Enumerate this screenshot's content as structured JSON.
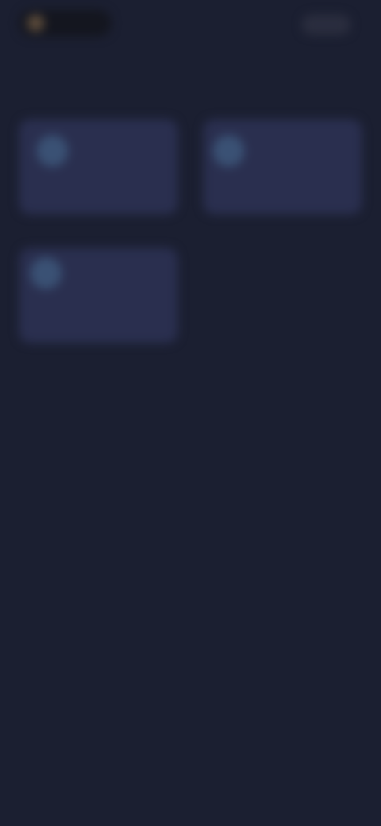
{
  "header": {
    "brand_name": "",
    "action_label": ""
  },
  "page": {
    "title": ""
  },
  "cards": [
    {
      "label": "",
      "icon": "app-icon"
    },
    {
      "label": "",
      "icon": "app-icon"
    },
    {
      "label": "",
      "icon": "app-icon"
    }
  ],
  "colors": {
    "background": "#1b1f31",
    "card": "#2a2f4f",
    "icon": "#3a5174"
  }
}
